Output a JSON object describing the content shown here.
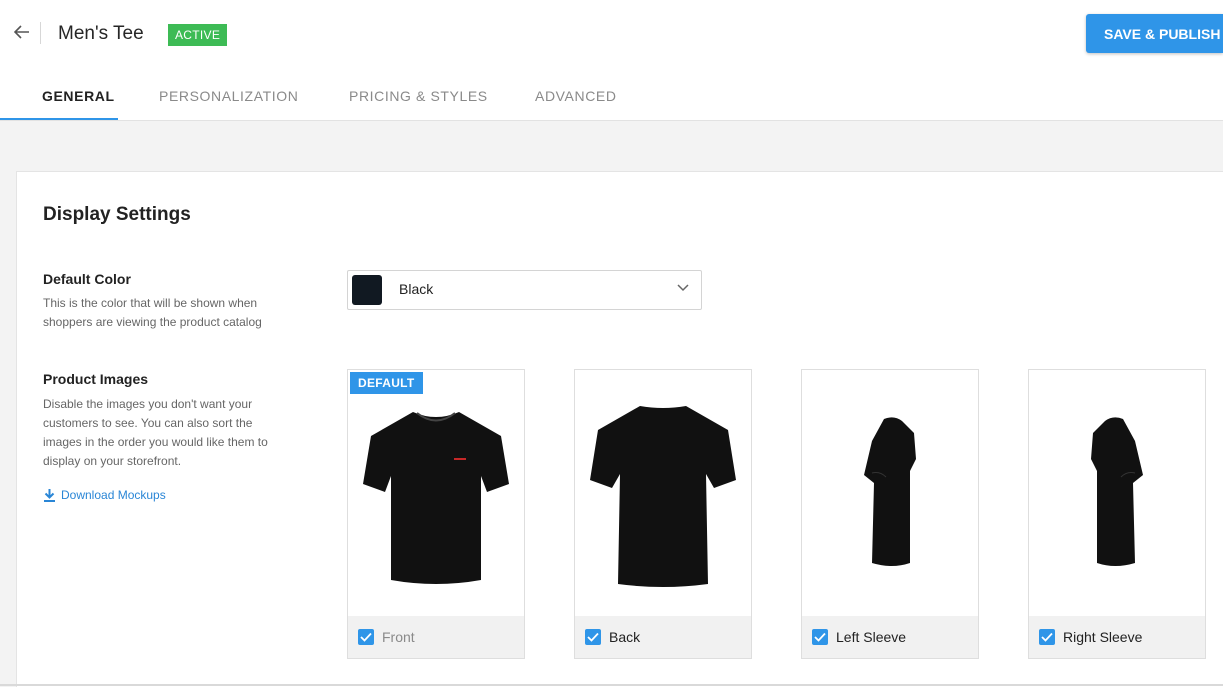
{
  "header": {
    "title": "Men's Tee",
    "status": "ACTIVE",
    "save_label": "SAVE & PUBLISH"
  },
  "tabs": [
    {
      "label": "GENERAL",
      "active": true
    },
    {
      "label": "PERSONALIZATION",
      "active": false
    },
    {
      "label": "PRICING & STYLES",
      "active": false
    },
    {
      "label": "ADVANCED",
      "active": false
    }
  ],
  "display_settings": {
    "title": "Display Settings",
    "default_color": {
      "label": "Default Color",
      "help": "This is the color that will be shown when shoppers are viewing the product catalog",
      "value": "Black",
      "swatch": "#111922"
    },
    "product_images": {
      "label": "Product Images",
      "help": "Disable the images you don't want your customers to see. You can also sort the images in the order you would like them to display on your storefront.",
      "download_label": "Download Mockups",
      "default_badge": "DEFAULT",
      "images": [
        {
          "label": "Front",
          "checked": true,
          "icon": "tshirt-front-icon"
        },
        {
          "label": "Back",
          "checked": true,
          "icon": "tshirt-back-icon"
        },
        {
          "label": "Left Sleeve",
          "checked": true,
          "icon": "tshirt-left-sleeve-icon"
        },
        {
          "label": "Right Sleeve",
          "checked": true,
          "icon": "tshirt-right-sleeve-icon"
        }
      ]
    }
  },
  "colors": {
    "accent": "#2f95e8",
    "active_badge": "#3dbb55",
    "checkbox": "#2f95e8",
    "link": "#2a86d6"
  }
}
